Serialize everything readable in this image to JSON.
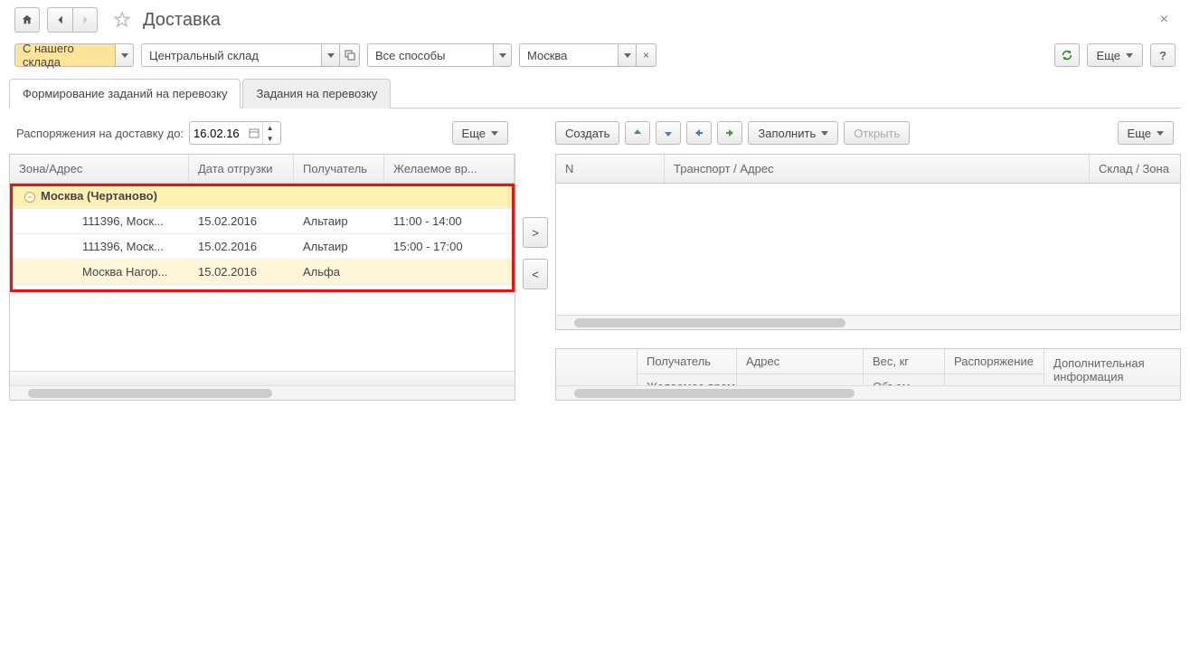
{
  "title": "Доставка",
  "topSelectors": {
    "source": "С нашего склада",
    "warehouse": "Центральный склад",
    "method": "Все способы",
    "city": "Москва"
  },
  "more": "Еще",
  "tabs": {
    "t1": "Формирование заданий на перевозку",
    "t2": "Задания на перевозку"
  },
  "left": {
    "label": "Распоряжения на доставку до:",
    "date": "16.02.16",
    "cols": {
      "c1": "Зона/Адрес",
      "c2": "Дата отгрузки",
      "c3": "Получатель",
      "c4": "Желаемое вр..."
    },
    "group": "Москва (Чертаново)",
    "rows": [
      {
        "addr": "111396, Моск...",
        "date": "15.02.2016",
        "recv": "Альтаир",
        "time": "11:00 - 14:00"
      },
      {
        "addr": "111396, Моск...",
        "date": "15.02.2016",
        "recv": "Альтаир",
        "time": "15:00 - 17:00"
      },
      {
        "addr": "Москва Нагор...",
        "date": "15.02.2016",
        "recv": "Альфа",
        "time": ""
      }
    ]
  },
  "right": {
    "create": "Создать",
    "fill": "Заполнить",
    "open": "Открыть",
    "cols": {
      "c1": "N",
      "c2": "Транспорт / Адрес",
      "c3": "Склад / Зона"
    },
    "detail": {
      "recv": "Получатель",
      "addr": "Адрес",
      "weight": "Вес, кг",
      "order": "Распоряжение",
      "extra": "Дополнительная информация",
      "wtime": "Желаемое время",
      "volume": "Объем,"
    }
  },
  "move": {
    "right": ">",
    "left": "<"
  }
}
